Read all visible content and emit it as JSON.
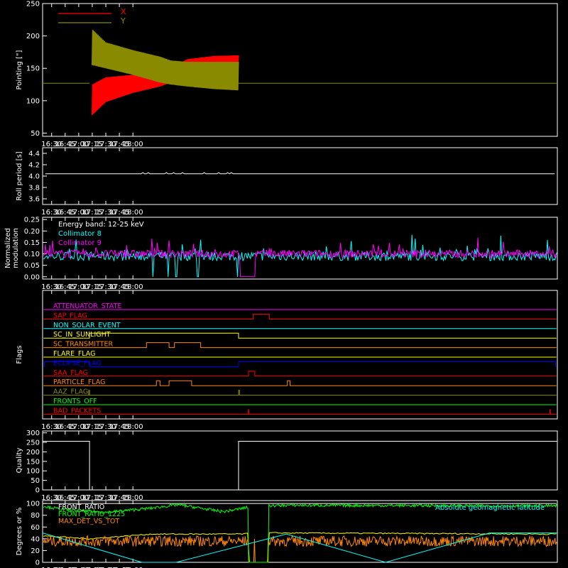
{
  "colors": {
    "background": "#000000",
    "axis": "#ffffff",
    "red": "#ff0000",
    "olive": "#8a8a00",
    "cyan": "#00ffff",
    "magenta": "#ff00ff",
    "green": "#00ff00",
    "yellow": "#ffff00",
    "orange": "#ff8800",
    "blue": "#0000ff",
    "white": "#ffffff"
  },
  "time_ticks": [
    "16:30",
    "16:45",
    "17:00",
    "17:15",
    "17:30",
    "17:45",
    "18:00"
  ],
  "chart_data": [
    {
      "id": "pointing",
      "type": "line",
      "ylabel": "Pointing [\"]",
      "xlim_minutes": [
        1580,
        2150
      ],
      "ylim": [
        45,
        250
      ],
      "yticks": [
        50,
        100,
        150,
        200,
        250
      ],
      "legend_position": "top-left",
      "series": [
        {
          "name": "X",
          "color": "red",
          "envelope": {
            "t": [
              1632,
              1635,
              1650,
              1680,
              1710,
              1722,
              1740,
              1770,
              1797
            ],
            "lo": [
              125,
              78,
              98,
              112,
              122,
              128,
              140,
              145,
              148
            ],
            "hi": [
              125,
              125,
              136,
              140,
              142,
              150,
              164,
              169,
              170
            ]
          }
        },
        {
          "name": "Y",
          "color": "olive",
          "envelope": {
            "t": [
              1632,
              1635,
              1650,
              1680,
              1710,
              1722,
              1740,
              1770,
              1797
            ],
            "lo": [
              125,
              155,
              150,
              140,
              128,
              125,
              122,
              118,
              116
            ],
            "hi": [
              125,
              210,
              190,
              178,
              168,
              162,
              160,
              160,
              160
            ]
          }
        }
      ],
      "baseline_value": 127
    },
    {
      "id": "roll-period",
      "type": "line",
      "ylabel": "Roll period [s]",
      "xlim_minutes": [
        1580,
        2150
      ],
      "ylim": [
        3.5,
        4.5
      ],
      "yticks": [
        "3.6",
        "3.8",
        "4.0",
        "4.2",
        "4.4"
      ],
      "series": [
        {
          "name": "",
          "color": "white",
          "value": 4.04
        }
      ]
    },
    {
      "id": "modulation",
      "type": "line",
      "ylabel_lines": [
        "Normalized",
        "modulation"
      ],
      "xlim_minutes": [
        1580,
        2150
      ],
      "ylim": [
        -0.01,
        0.26
      ],
      "yticks": [
        "0.00",
        "0.05",
        "0.10",
        "0.15",
        "0.20",
        "0.25"
      ],
      "annotation": "Energy band: 12-25 keV",
      "series": [
        {
          "name": "Collimator 8",
          "color": "cyan",
          "baseline": 0.09,
          "dropouts_minutes": [
            1702,
            1719,
            1728,
            1752,
            1796
          ]
        },
        {
          "name": "Collimator 9",
          "color": "magenta",
          "baseline": 0.1,
          "gap_minutes": [
            1798,
            1816
          ]
        }
      ]
    },
    {
      "id": "flags",
      "type": "line",
      "ylabel": "Flags",
      "xlim_minutes": [
        1580,
        2150
      ],
      "rows": [
        {
          "label": "ATTENUATOR_STATE",
          "color": "magenta",
          "steps": []
        },
        {
          "label": "SAP_FLAG",
          "color": "red",
          "steps": [
            [
              1813,
              1831
            ]
          ]
        },
        {
          "label": "NON_SOLAR_EVENT",
          "color": "cyan",
          "steps": []
        },
        {
          "label": "SC_IN_SUNLIGHT",
          "color": "yellow",
          "steps": [
            [
              1632,
              1797
            ]
          ],
          "inverted": true
        },
        {
          "label": "SC_TRANSMITTER",
          "color": "orange",
          "steps": [
            [
              1695,
              1720
            ],
            [
              1726,
              1755
            ]
          ]
        },
        {
          "label": "FLARE_FLAG",
          "color": "yellow",
          "steps": []
        },
        {
          "label": "ECLIPSE_FLAG",
          "color": "blue",
          "steps": [
            [
              1582,
              1632
            ],
            [
              1797,
              2148
            ]
          ]
        },
        {
          "label": "SAA_FLAG",
          "color": "red",
          "steps": [
            [
              1808,
              1815
            ]
          ]
        },
        {
          "label": "PARTICLE_FLAG",
          "color": "orange",
          "steps": [
            [
              1706,
              1710
            ],
            [
              1720,
              1745
            ],
            [
              1851,
              1854
            ]
          ]
        },
        {
          "label": "AAZ_FLAG",
          "color": "olive",
          "steps": [
            [
              1631,
              1632
            ],
            [
              1797,
              1798
            ]
          ]
        },
        {
          "label": "FRONTS_OFF",
          "color": "green",
          "steps": []
        },
        {
          "label": "BAD_PACKETS",
          "color": "red",
          "steps": [],
          "spikes_minutes": [
            1808,
            2142
          ]
        }
      ]
    },
    {
      "id": "quality",
      "type": "line",
      "ylabel": "Quality",
      "xlim_minutes": [
        1580,
        2150
      ],
      "ylim": [
        0,
        310
      ],
      "yticks": [
        0,
        50,
        100,
        150,
        200,
        250,
        300
      ],
      "series": [
        {
          "name": "",
          "color": "white",
          "segments": [
            {
              "t": [
                1580,
                1632
              ],
              "value": 256
            },
            {
              "t": [
                1632,
                1797
              ],
              "value": 0
            },
            {
              "t": [
                1797,
                2150
              ],
              "value": 256
            }
          ]
        }
      ]
    },
    {
      "id": "ratios",
      "type": "line",
      "ylabel": "Degrees or %",
      "xlim_minutes": [
        1580,
        2150
      ],
      "ylim": [
        0,
        105
      ],
      "yticks": [
        0,
        20,
        40,
        60,
        80,
        100
      ],
      "series": [
        {
          "name": "FRONT_RATIO",
          "color": "white",
          "baseline": 100
        },
        {
          "name": "FRONT_RATIO_1225",
          "color": "green",
          "levels": {
            "t": [
              1580,
              1600,
              1650,
              1700,
              1730,
              1780,
              1813,
              1850,
              2150
            ],
            "v": [
              96,
              90,
              85,
              92,
              98,
              86,
              95,
              97,
              96
            ]
          }
        },
        {
          "name": "MAX_DET_VS_TOT",
          "color": "orange",
          "baseline": 36
        },
        {
          "name": "Absolute geomagnetic latitude",
          "color": "cyan",
          "points": {
            "t": [
              1580,
              1690,
              1728,
              1850,
              1960,
              2075,
              2150
            ],
            "v": [
              50,
              0,
              0,
              48,
              0,
              50,
              50
            ]
          }
        },
        {
          "name": "",
          "color": "yellow",
          "levels": {
            "t": [
              1580,
              1632,
              1700,
              1797,
              1830,
              2150
            ],
            "v": [
              45,
              40,
              48,
              48,
              50,
              48
            ]
          }
        }
      ],
      "legend_position": "top-left"
    }
  ]
}
